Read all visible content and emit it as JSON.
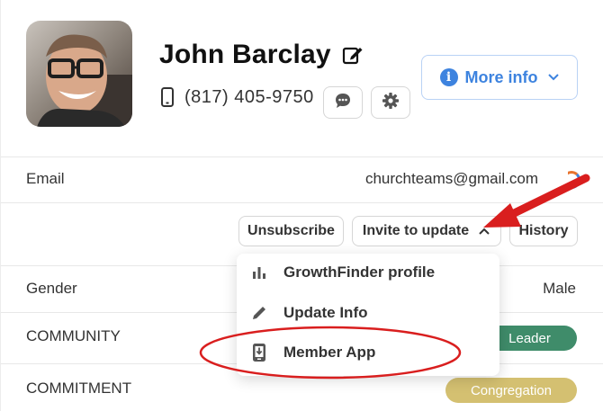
{
  "profile": {
    "name": "John Barclay",
    "phone": "(817) 405-9750"
  },
  "header": {
    "more_info_label": "More info",
    "info_glyph": "i"
  },
  "fields": {
    "email_label": "Email",
    "email_value": "churchteams@gmail.com",
    "gender_label": "Gender",
    "gender_value": "Male",
    "community_label": "COMMUNITY",
    "community_badge": "Leader",
    "commitment_label": "COMMITMENT",
    "commitment_badge": "Congregation"
  },
  "actions": {
    "unsubscribe_label": "Unsubscribe",
    "invite_label": "Invite to update",
    "history_label": "History"
  },
  "invite_menu": {
    "items": [
      {
        "label": "GrowthFinder profile",
        "icon": "bar-chart-icon"
      },
      {
        "label": "Update Info",
        "icon": "pencil-icon"
      },
      {
        "label": "Member App",
        "icon": "phone-download-icon"
      }
    ]
  },
  "colors": {
    "accent_blue": "#3d83df",
    "leader_green": "#3f8c6a",
    "congregation_gold": "#d4c071",
    "annotation_red": "#d91e1e"
  }
}
